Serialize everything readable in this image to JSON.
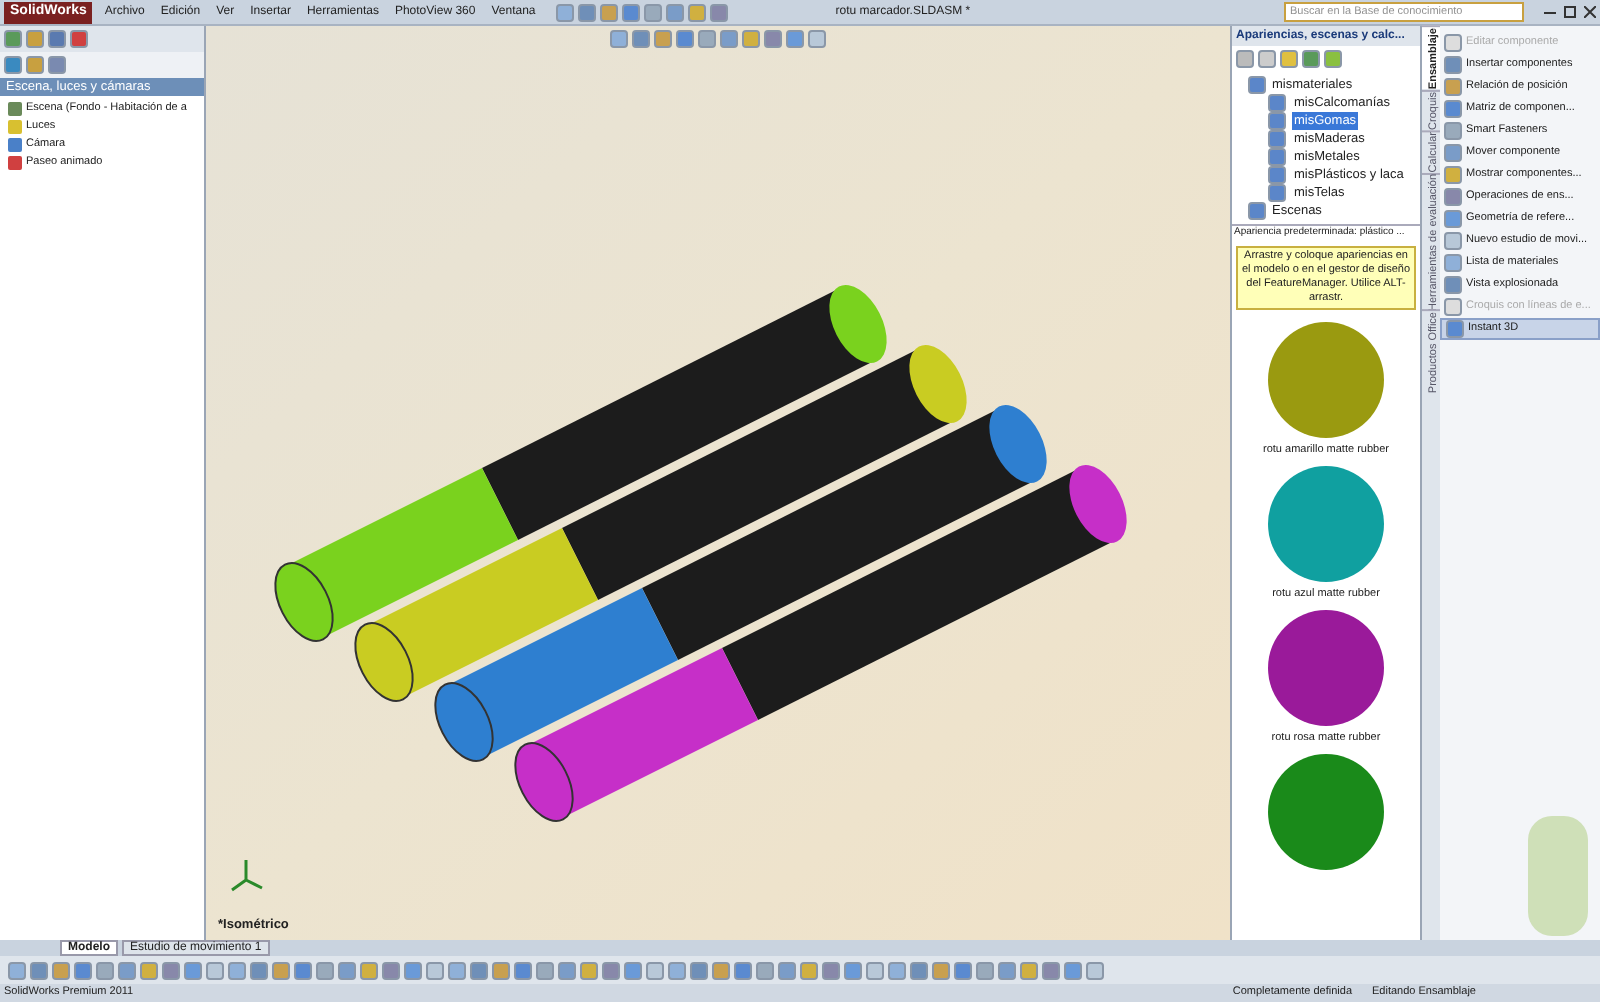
{
  "app": {
    "logo": "SolidWorks",
    "menu": [
      "Archivo",
      "Edición",
      "Ver",
      "Insertar",
      "Herramientas",
      "PhotoView 360",
      "Ventana"
    ],
    "title": "rotu marcador.SLDASM *",
    "search": {
      "placeholder": "Buscar en la Base de conocimiento"
    }
  },
  "left_panel": {
    "title": "Escena, luces y cámaras",
    "tree": [
      {
        "label": "Escena (Fondo - Habitación de a",
        "kind": "scene"
      },
      {
        "label": "Luces",
        "kind": "light"
      },
      {
        "label": "Cámara",
        "kind": "camera"
      },
      {
        "label": "Paseo animado",
        "kind": "walk"
      }
    ]
  },
  "viewport": {
    "view_label": "*Isométrico",
    "pens": [
      {
        "color": "#7ad21e"
      },
      {
        "color": "#c9cc22"
      },
      {
        "color": "#2e7fd0"
      },
      {
        "color": "#c62fc8"
      }
    ]
  },
  "appearances": {
    "title": "Apariencias, escenas y calc...",
    "tree": [
      {
        "label": "mismateriales",
        "children": [
          {
            "label": "misCalcomanías",
            "selected": false
          },
          {
            "label": "misGomas",
            "selected": true
          },
          {
            "label": "misMaderas",
            "selected": false
          },
          {
            "label": "misMetales",
            "selected": false
          },
          {
            "label": "misPlásticos y laca",
            "selected": false
          },
          {
            "label": "misTelas",
            "selected": false
          }
        ]
      },
      {
        "label": "Escenas"
      }
    ],
    "default_label": "Apariencia predeterminada: plástico ...",
    "hint": "Arrastre y coloque apariencias en el modelo o en el gestor de diseño del FeatureManager. Utilice ALT-arrastr.",
    "swatches": [
      {
        "label": "rotu amarillo matte rubber",
        "color": "#9a9a10"
      },
      {
        "label": "rotu azul matte rubber",
        "color": "#10a0a0"
      },
      {
        "label": "rotu rosa matte rubber",
        "color": "#9a1a9a"
      },
      {
        "color": "#1a8a1a"
      }
    ]
  },
  "command_tabs": [
    {
      "label": "Ensamblaje",
      "selected": true
    },
    {
      "label": "Croquis",
      "selected": false
    },
    {
      "label": "Calcular",
      "selected": false
    },
    {
      "label": "Herramientas de evaluación",
      "selected": false
    },
    {
      "label": "Productos Office",
      "selected": false
    }
  ],
  "commands": [
    {
      "label": "Editar componente",
      "disabled": true,
      "selected": false
    },
    {
      "label": "Insertar componentes",
      "disabled": false,
      "selected": false
    },
    {
      "label": "Relación de posición",
      "disabled": false,
      "selected": false
    },
    {
      "label": "Matriz de componen...",
      "disabled": false,
      "selected": false
    },
    {
      "label": "Smart Fasteners",
      "disabled": false,
      "selected": false
    },
    {
      "label": "Mover componente",
      "disabled": false,
      "selected": false
    },
    {
      "label": "Mostrar componentes...",
      "disabled": false,
      "selected": false
    },
    {
      "label": "Operaciones de ens...",
      "disabled": false,
      "selected": false
    },
    {
      "label": "Geometría de refere...",
      "disabled": false,
      "selected": false
    },
    {
      "label": "Nuevo estudio de movi...",
      "disabled": false,
      "selected": false
    },
    {
      "label": "Lista de materiales",
      "disabled": false,
      "selected": false
    },
    {
      "label": "Vista explosionada",
      "disabled": false,
      "selected": false
    },
    {
      "label": "Croquis con líneas de e...",
      "disabled": true,
      "selected": false
    },
    {
      "label": "Instant 3D",
      "disabled": false,
      "selected": true
    }
  ],
  "bottom_tabs": [
    {
      "label": "Modelo",
      "selected": true
    },
    {
      "label": "Estudio de movimiento 1",
      "selected": false
    }
  ],
  "status_bar": {
    "product": "SolidWorks Premium 2011",
    "state": "Completamente definida",
    "mode": "Editando Ensamblaje"
  }
}
